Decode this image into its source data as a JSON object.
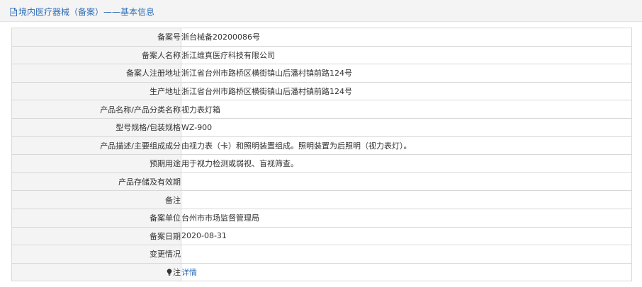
{
  "header": {
    "icon": "document-icon",
    "title": "境内医疗器械（备案）——基本信息"
  },
  "rows": [
    {
      "label": "备案号",
      "value": "浙台械备20200086号"
    },
    {
      "label": "备案人名称",
      "value": "浙江维真医疗科技有限公司"
    },
    {
      "label": "备案人注册地址",
      "value": "浙江省台州市路桥区横街镇山后潘村镇前路124号"
    },
    {
      "label": "生产地址",
      "value": "浙江省台州市路桥区横街镇山后潘村镇前路124号"
    },
    {
      "label": "产品名称/产品分类名称",
      "value": "视力表灯箱"
    },
    {
      "label": "型号规格/包装规格",
      "value": "WZ-900"
    },
    {
      "label": "产品描述/主要组成成分",
      "value": "由视力表（卡）和照明装置组成。照明装置为后照明（视力表灯）。"
    },
    {
      "label": "预期用途",
      "value": "用于视力检测或弱视、盲视筛查。"
    },
    {
      "label": "产品存储及有效期",
      "value": ""
    },
    {
      "label": "备注",
      "value": ""
    },
    {
      "label": "备案单位",
      "value": "台州市市场监督管理局"
    },
    {
      "label": "备案日期",
      "value": "2020-08-31"
    },
    {
      "label": "变更情况",
      "value": ""
    }
  ],
  "note_row": {
    "icon": "lightbulb-icon",
    "label": "注",
    "link_text": "详情",
    "link_color": "#2f6db5"
  }
}
